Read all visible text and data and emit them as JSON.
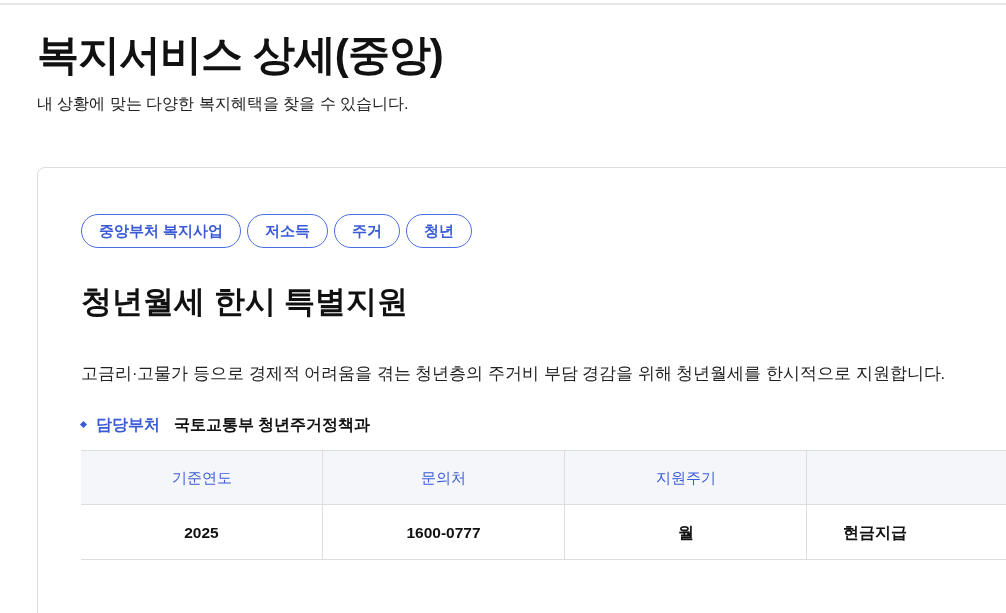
{
  "page": {
    "title": "복지서비스 상세(중앙)",
    "subtitle": "내 상황에 맞는 다양한 복지혜택을 찾을 수 있습니다."
  },
  "service": {
    "tags": [
      "중앙부처 복지사업",
      "저소득",
      "주거",
      "청년"
    ],
    "title": "청년월세 한시 특별지원",
    "description": "고금리·고물가 등으로 경제적 어려움을 겪는 청년층의 주거비 부담 경감을 위해 청년월세를 한시적으로 지원합니다.",
    "department": {
      "label": "담당부처",
      "value": "국토교통부 청년주거정책과"
    },
    "table": {
      "columns": [
        "기준연도",
        "문의처",
        "지원주기"
      ],
      "rows": [
        [
          "2025",
          "1600-0777",
          "월",
          "현금지급"
        ]
      ]
    }
  }
}
